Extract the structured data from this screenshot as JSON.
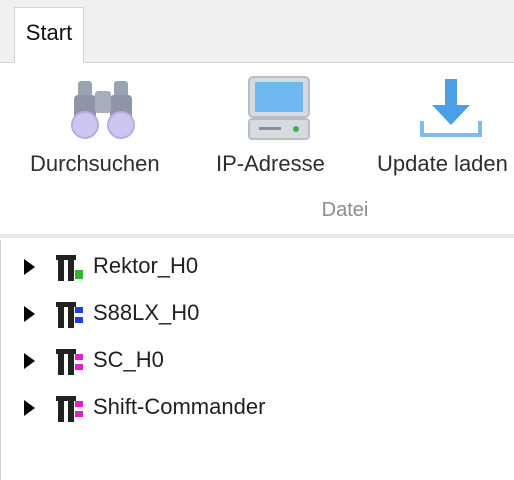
{
  "tabs": [
    {
      "label": "Start"
    }
  ],
  "ribbon": {
    "buttons": [
      {
        "label": "Durchsuchen",
        "icon": "binoculars-icon"
      },
      {
        "label": "IP-Adresse",
        "icon": "monitor-icon"
      },
      {
        "label": "Update laden",
        "icon": "download-icon"
      }
    ],
    "group_label": "Datei"
  },
  "tree": {
    "items": [
      {
        "label": "Rektor_H0",
        "icon": "device-icon",
        "color": "#2fb52f"
      },
      {
        "label": "S88LX_H0",
        "icon": "device-icon",
        "color": "#1f3fe0"
      },
      {
        "label": "SC_H0",
        "icon": "device-icon",
        "color": "#e021c8"
      },
      {
        "label": "Shift-Commander",
        "icon": "device-icon",
        "color": "#e021c8"
      }
    ]
  }
}
